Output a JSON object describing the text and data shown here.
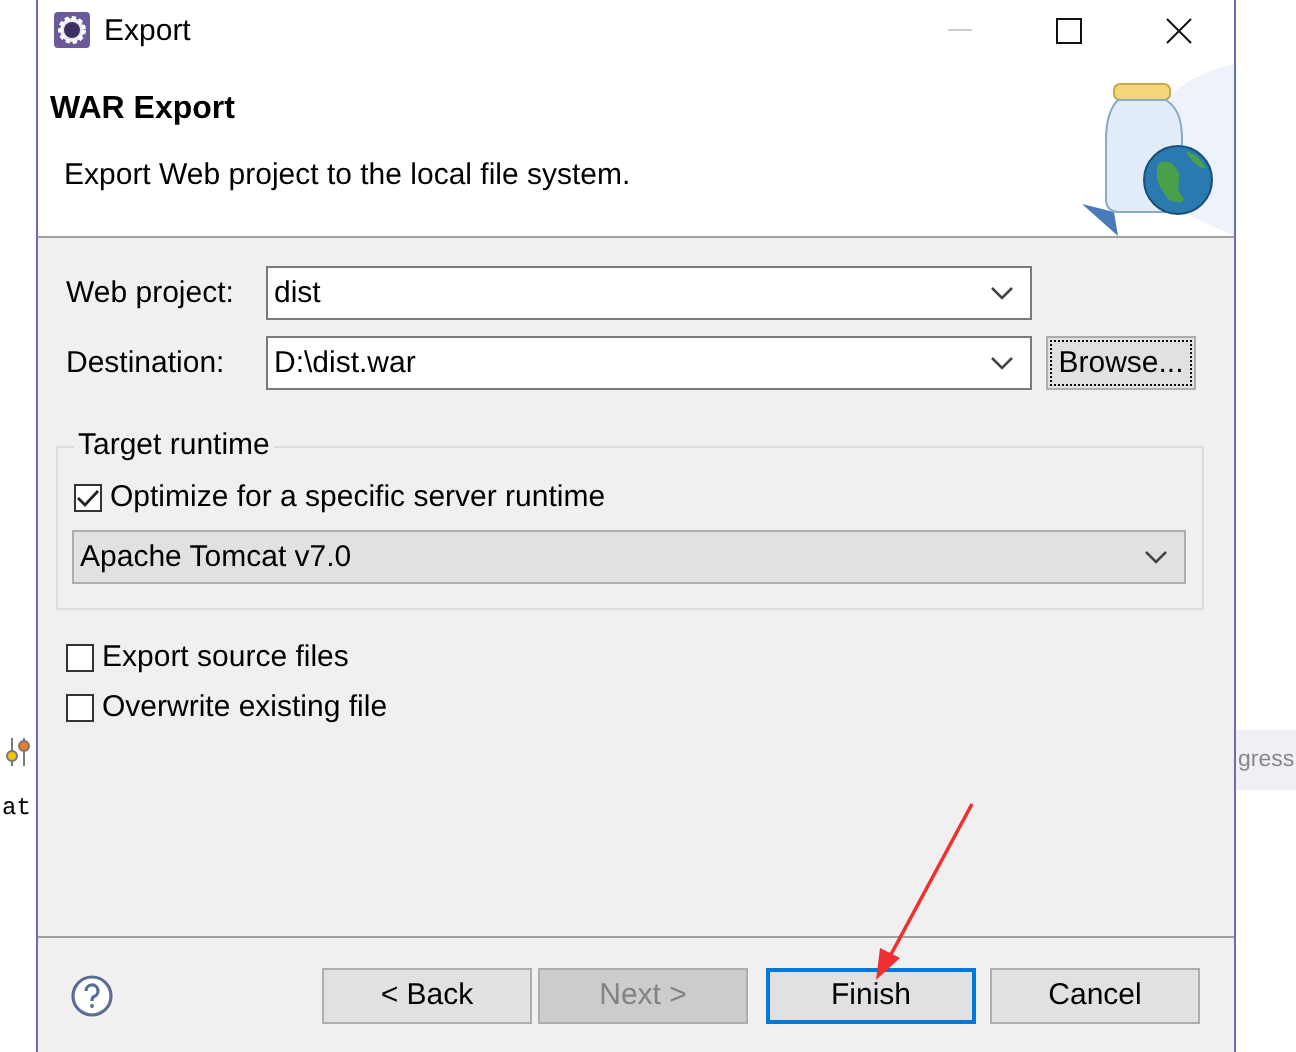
{
  "window": {
    "title": "Export"
  },
  "header": {
    "title": "WAR Export",
    "description": "Export Web project to the local file system."
  },
  "fields": [
    {
      "label": "Web project:",
      "value": "dist"
    },
    {
      "label": "Destination:",
      "value": "D:\\dist.war",
      "browse": {
        "label": "Browse...",
        "focused": true
      }
    }
  ],
  "target_runtime": {
    "legend": "Target runtime",
    "optimize": {
      "label": "Optimize for a specific server runtime",
      "checked": true
    },
    "runtime": "Apache Tomcat v7.0"
  },
  "options": [
    {
      "label": "Export source files",
      "checked": false
    },
    {
      "label": "Overwrite existing file",
      "checked": false
    }
  ],
  "buttons": [
    {
      "label": "< Back",
      "disabled": false,
      "focused": false
    },
    {
      "label": "Next >",
      "disabled": true,
      "focused": false
    },
    {
      "label": "Finish",
      "disabled": false,
      "focused": true
    },
    {
      "label": "Cancel",
      "disabled": false,
      "focused": false
    }
  ],
  "background": {
    "left_text": "at",
    "right_text": "gress"
  }
}
